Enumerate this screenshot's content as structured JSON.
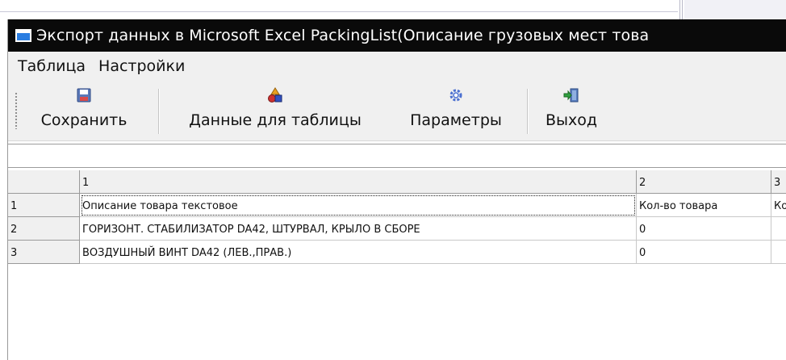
{
  "window": {
    "title": "Экспорт данных в Microsoft Excel PackingList(Описание грузовых мест това"
  },
  "menu": [
    {
      "label": "Таблица"
    },
    {
      "label": "Настройки"
    }
  ],
  "toolbar": {
    "save_label": "Сохранить",
    "data_label": "Данные для таблицы",
    "params_label": "Параметры",
    "exit_label": "Выход"
  },
  "filter": {
    "value": ""
  },
  "grid": {
    "column_headers": [
      "1",
      "2",
      "3"
    ],
    "rows": [
      {
        "num": "1",
        "cells": [
          "Описание товара текстовое",
          "Кол-во товара",
          "Ко"
        ]
      },
      {
        "num": "2",
        "cells": [
          "ГОРИЗОНТ. СТАБИЛИЗАТОР DA42, ШТУРВАЛ, КРЫЛО В СБОРЕ",
          "0",
          ""
        ]
      },
      {
        "num": "3",
        "cells": [
          "ВОЗДУШНЫЙ ВИНТ DA42 (ЛЕВ.,ПРАВ.)",
          "0",
          ""
        ]
      }
    ]
  },
  "icons": {
    "window": "window-app-icon",
    "save": "floppy-disk-icon",
    "data": "shapes-data-icon",
    "params": "gear-icon",
    "exit": "door-exit-icon"
  }
}
